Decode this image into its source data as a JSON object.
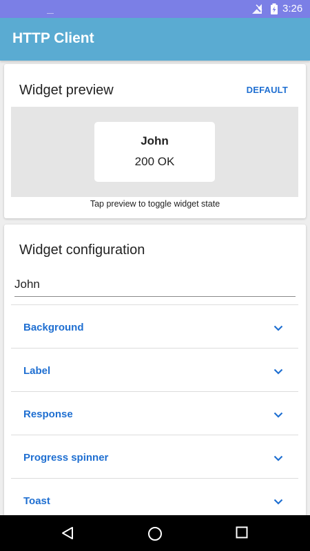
{
  "status_bar": {
    "time": "3:26",
    "icons": [
      "no-signal-icon",
      "battery-charging-icon"
    ]
  },
  "app_bar": {
    "title": "HTTP Client"
  },
  "widget_preview": {
    "title": "Widget preview",
    "default_label": "DEFAULT",
    "widget": {
      "label": "John",
      "response": "200 OK"
    },
    "hint": "Tap preview to toggle widget state"
  },
  "widget_configuration": {
    "title": "Widget configuration",
    "name_value": "John",
    "sections": [
      {
        "label": "Background"
      },
      {
        "label": "Label"
      },
      {
        "label": "Response"
      },
      {
        "label": "Progress spinner"
      },
      {
        "label": "Toast"
      }
    ]
  },
  "nav_bar": {
    "icons": [
      "back-icon",
      "home-icon",
      "recents-icon"
    ]
  },
  "colors": {
    "status_bar": "#7b7fe6",
    "app_bar": "#5aabd2",
    "accent": "#1f6fd1"
  }
}
